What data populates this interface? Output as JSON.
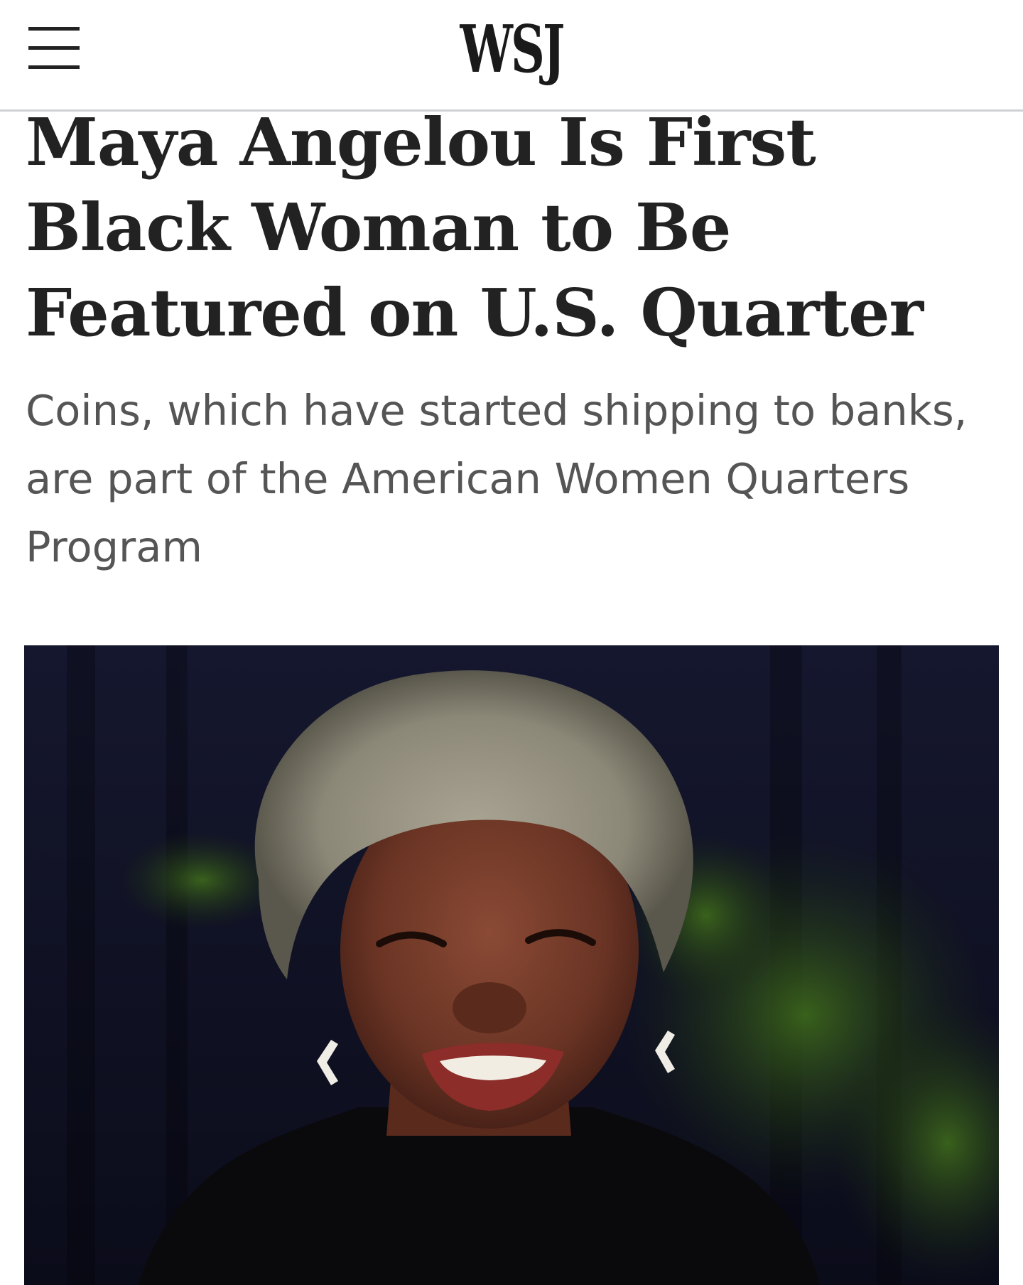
{
  "header": {
    "logo": "WSJ",
    "menu_icon": "hamburger-menu-icon"
  },
  "article": {
    "headline": "Maya Angelou Is First Black Woman to Be Featured on U.S. Quarter",
    "dek": "Coins, which have started shipping to banks, are part of the American Women Quarters Program"
  },
  "colors": {
    "headline": "#222222",
    "dek": "#555555",
    "divider": "#cfd2d4"
  }
}
